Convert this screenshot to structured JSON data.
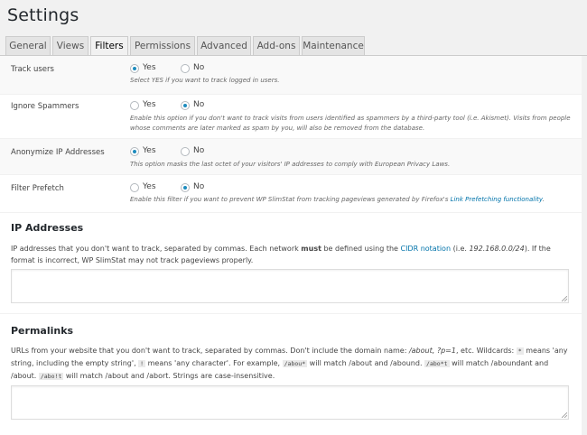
{
  "page": {
    "title": "Settings"
  },
  "tabs": [
    {
      "label": "General"
    },
    {
      "label": "Views"
    },
    {
      "label": "Filters"
    },
    {
      "label": "Permissions"
    },
    {
      "label": "Advanced"
    },
    {
      "label": "Add-ons"
    },
    {
      "label": "Maintenance"
    }
  ],
  "active_tab": "Filters",
  "rows": [
    {
      "label": "Track users",
      "yes": "Yes",
      "no": "No",
      "selected": "Yes",
      "hint": "Select YES if you want to track logged in users."
    },
    {
      "label": "Ignore Spammers",
      "yes": "Yes",
      "no": "No",
      "selected": "No",
      "hint": "Enable this option if you don't want to track visits from users identified as spammers by a third-party tool (i.e. Akismet). Visits from people whose comments are later marked as spam by you, will also be removed from the database."
    },
    {
      "label": "Anonymize IP Addresses",
      "yes": "Yes",
      "no": "No",
      "selected": "Yes",
      "hint": "This option masks the last octet of your visitors' IP addresses to comply with European Privacy Laws."
    },
    {
      "label": "Filter Prefetch",
      "yes": "Yes",
      "no": "No",
      "selected": "No",
      "hint_pre": "Enable this filter if you want to prevent WP SlimStat from tracking pageviews generated by Firefox's ",
      "hint_link": "Link Prefetching functionality",
      "hint_post": "."
    }
  ],
  "ip_section": {
    "title": "IP Addresses",
    "desc_1": "IP addresses that you don't want to track, separated by commas. Each network ",
    "desc_bold": "must",
    "desc_2": " be defined using the ",
    "desc_link": "CIDR notation",
    "desc_3": " (i.e. ",
    "desc_example": "192.168.0.0/24",
    "desc_4": "). If the format is incorrect, WP SlimStat may not track pageviews properly.",
    "value": ""
  },
  "permalinks_section": {
    "title": "Permalinks",
    "d1": "URLs from your website that you don't want to track, separated by commas. Don't include the domain name: ",
    "d1_ex": "/about, ?p=1",
    "d2": ", etc. Wildcards: ",
    "c1": "*",
    "d3": " means 'any string, including the empty string', ",
    "c2": "!",
    "d4": " means 'any character'. For example, ",
    "c3": "/abou*",
    "d5": " will match /about and /abound. ",
    "c4": "/abo*t",
    "d6": " will match /aboundant and /about. ",
    "c5": "/abo!t",
    "d7": " will match /about and /abort. Strings are case-insensitive.",
    "value": ""
  },
  "icons": {
    "radio": "radio-button-icon",
    "resize": "resize-grip-icon"
  },
  "colors": {
    "link": "#0073aa",
    "radio_dot": "#1e8cbe"
  }
}
